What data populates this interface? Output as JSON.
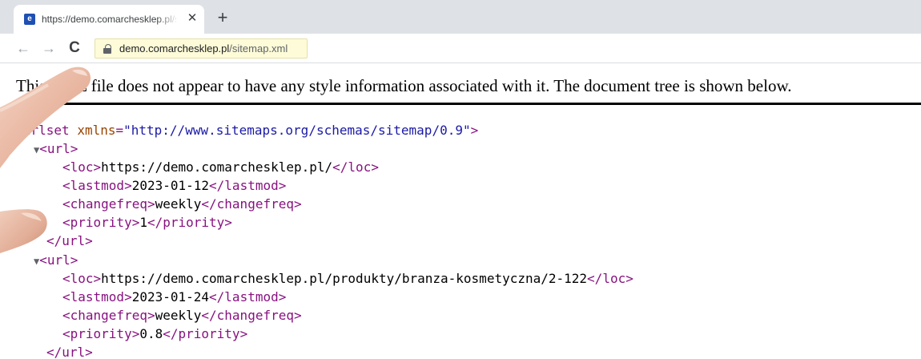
{
  "browser": {
    "tab": {
      "title": "https://demo.comarchesklep.pl/sitemap.xml",
      "close_glyph": "✕",
      "favicon_glyph": "e"
    },
    "new_tab_glyph": "+",
    "nav": {
      "back_glyph": "←",
      "forward_glyph": "→",
      "reload_glyph": "C"
    },
    "address_bar": {
      "host": "demo.comarchesklep.pl",
      "path": "/sitemap.xml",
      "icon": "lock-icon"
    }
  },
  "page": {
    "info_message": "This XML file does not appear to have any style information associated with it. The document tree is shown below.",
    "xml": {
      "toggle_glyph": "▼",
      "root": {
        "open_prefix": "<urlset",
        "attr_name": "xmlns",
        "attr_eq": "=",
        "attr_value": "\"http://www.sitemaps.org/schemas/sitemap/0.9\"",
        "open_suffix": ">"
      },
      "urls": [
        {
          "open_tag": "<url>",
          "close_tag": "</url>",
          "loc": {
            "open": "<loc>",
            "value": "https://demo.comarchesklep.pl/",
            "close": "</loc>"
          },
          "lastmod": {
            "open": "<lastmod>",
            "value": "2023-01-12",
            "close": "</lastmod>"
          },
          "changefreq": {
            "open": "<changefreq>",
            "value": "weekly",
            "close": "</changefreq>"
          },
          "priority": {
            "open": "<priority>",
            "value": "1",
            "close": "</priority>"
          }
        },
        {
          "open_tag": "<url>",
          "close_tag": "</url>",
          "loc": {
            "open": "<loc>",
            "value": "https://demo.comarchesklep.pl/produkty/branza-kosmetyczna/2-122",
            "close": "</loc>"
          },
          "lastmod": {
            "open": "<lastmod>",
            "value": "2023-01-24",
            "close": "</lastmod>"
          },
          "changefreq": {
            "open": "<changefreq>",
            "value": "weekly",
            "close": "</changefreq>"
          },
          "priority": {
            "open": "<priority>",
            "value": "0.8",
            "close": "</priority>"
          }
        }
      ]
    }
  },
  "colors": {
    "tag": "#881280",
    "attribute": "#994500",
    "attribute_value": "#1a1aa6",
    "omnibox_highlight": "#fefbd8"
  }
}
